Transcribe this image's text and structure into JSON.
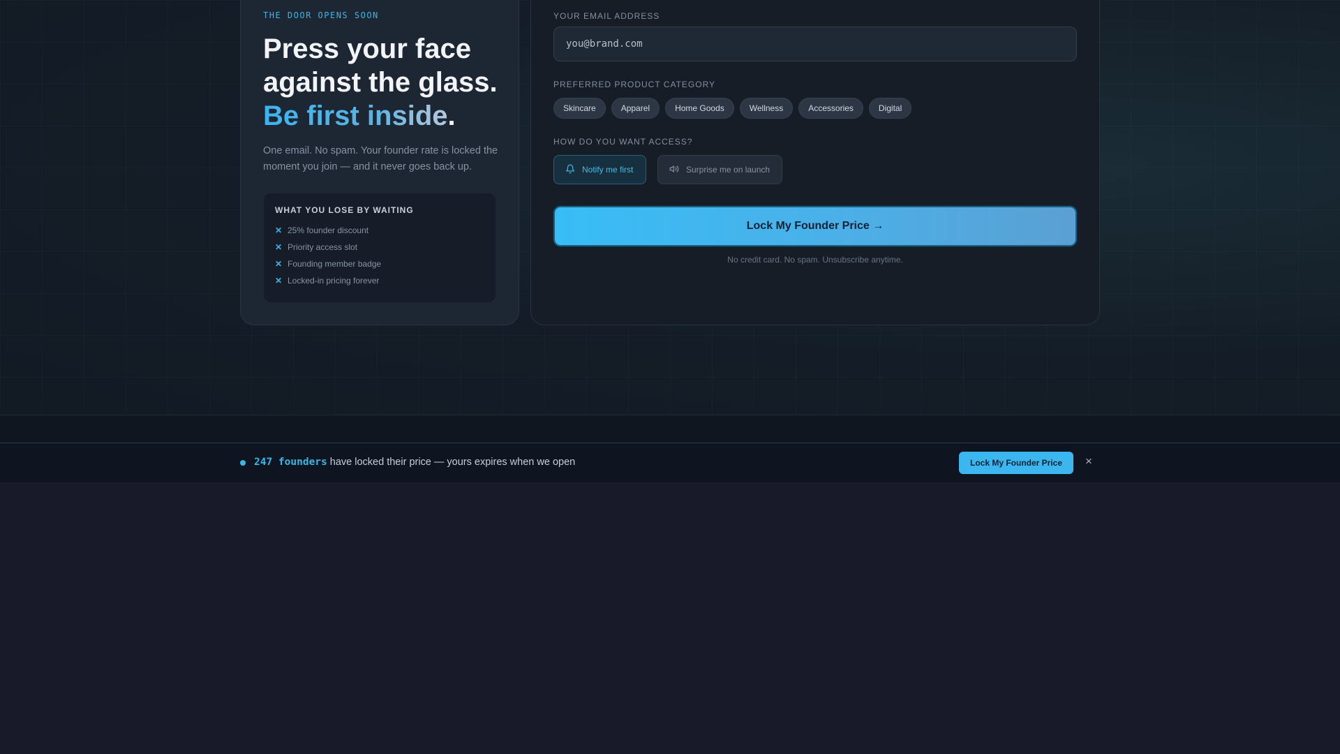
{
  "hero": {
    "eyebrow": "THE DOOR OPENS SOON",
    "headline_line1": "Press your face",
    "headline_line2": "against the glass.",
    "headline_accent": "Be first inside",
    "headline_period": ".",
    "subtext": "One email. No spam. Your founder rate is locked the moment you join — and it never goes back up."
  },
  "lose_box": {
    "title": "WHAT YOU LOSE BY WAITING",
    "items": [
      "25% founder discount",
      "Priority access slot",
      "Founding member badge",
      "Locked-in pricing forever"
    ]
  },
  "form": {
    "email_label": "YOUR EMAIL ADDRESS",
    "email_placeholder": "you@brand.com",
    "category_label": "PREFERRED PRODUCT CATEGORY",
    "categories": [
      "Skincare",
      "Apparel",
      "Home Goods",
      "Wellness",
      "Accessories",
      "Digital"
    ],
    "access_label": "HOW DO YOU WANT ACCESS?",
    "access_options": [
      {
        "label": "Notify me first",
        "icon": "bell-icon",
        "selected": true
      },
      {
        "label": "Surprise me on launch",
        "icon": "speaker-icon",
        "selected": false
      }
    ],
    "cta_label": "Lock My Founder Price →",
    "fine_print": "No credit card. No spam. Unsubscribe anytime."
  },
  "sticky_bar": {
    "count": "247 founders",
    "message": " have locked their price — yours expires when we open",
    "cta_label": "Lock My Founder Price",
    "close_label": "×"
  },
  "colors": {
    "accent": "#3bb6e6",
    "background": "#191a29"
  }
}
